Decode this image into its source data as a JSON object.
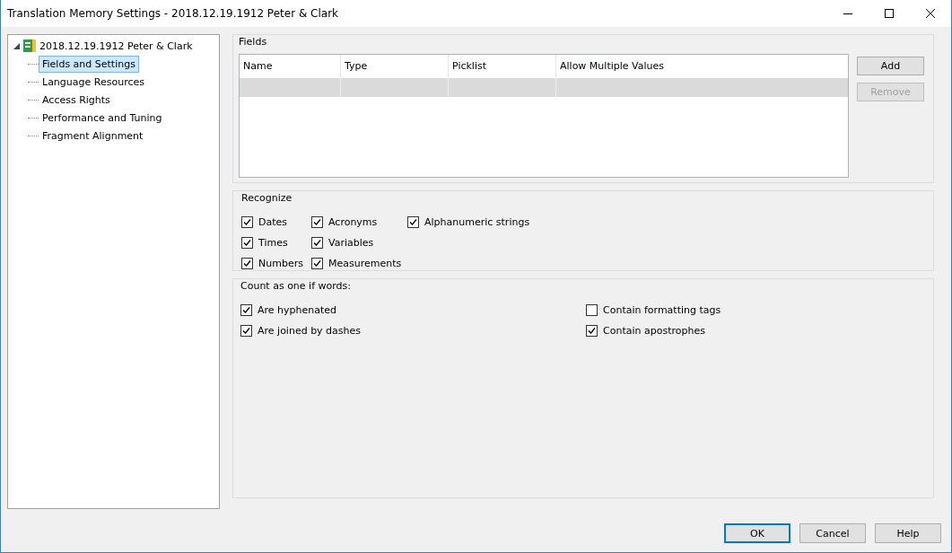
{
  "window": {
    "title": "Translation Memory Settings - 2018.12.19.1912 Peter & Clark"
  },
  "tree": {
    "label": "2018.12.19.1912 Peter & Clark",
    "expanded": true,
    "children": [
      {
        "label": "Fields and Settings",
        "selected": true
      },
      {
        "label": "Language Resources",
        "selected": false
      },
      {
        "label": "Access Rights",
        "selected": false
      },
      {
        "label": "Performance and Tuning",
        "selected": false
      },
      {
        "label": "Fragment Alignment",
        "selected": false
      }
    ]
  },
  "fields": {
    "title": "Fields",
    "columns": [
      "Name",
      "Type",
      "Picklist",
      "Allow Multiple Values"
    ],
    "rows": [
      {
        "selected": true
      }
    ],
    "buttons": [
      {
        "label": "Add",
        "disabled": false
      },
      {
        "label": "Remove",
        "disabled": true
      }
    ]
  },
  "recognize": {
    "title": "Recognize",
    "columns": [
      [
        {
          "label": "Dates",
          "checked": true
        },
        {
          "label": "Times",
          "checked": true
        },
        {
          "label": "Numbers",
          "checked": true
        }
      ],
      [
        {
          "label": "Acronyms",
          "checked": true
        },
        {
          "label": "Variables",
          "checked": true
        },
        {
          "label": "Measurements",
          "checked": true
        }
      ],
      [
        {
          "label": "Alphanumeric strings",
          "checked": true
        }
      ]
    ]
  },
  "count_as_one": {
    "title": "Count as one if words:",
    "columns": [
      [
        {
          "label": "Are hyphenated",
          "checked": true
        },
        {
          "label": "Are joined by dashes",
          "checked": true
        }
      ],
      [
        {
          "label": "Contain formatting tags",
          "checked": false
        },
        {
          "label": "Contain apostrophes",
          "checked": true
        }
      ]
    ]
  },
  "buttons": [
    {
      "label": "OK",
      "default": true
    },
    {
      "label": "Cancel",
      "default": false
    },
    {
      "label": "Help",
      "default": false
    }
  ]
}
